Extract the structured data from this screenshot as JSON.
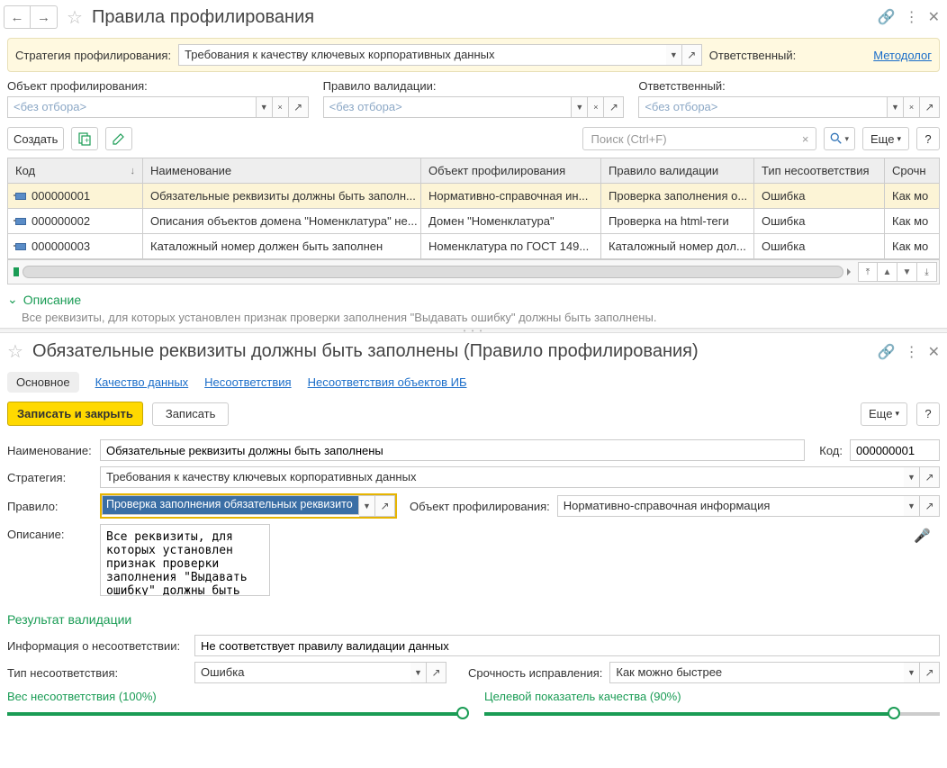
{
  "top": {
    "title": "Правила профилирования",
    "strategy_label": "Стратегия профилирования:",
    "strategy_value": "Требования к качеству ключевых корпоративных данных",
    "responsible_label": "Ответственный:",
    "responsible_link": "Методолог",
    "filters": [
      {
        "label": "Объект профилирования:",
        "placeholder": "<без отбора>"
      },
      {
        "label": "Правило валидации:",
        "placeholder": "<без отбора>"
      },
      {
        "label": "Ответственный:",
        "placeholder": "<без отбора>"
      }
    ],
    "toolbar": {
      "create": "Создать",
      "search_placeholder": "Поиск (Ctrl+F)",
      "more": "Еще",
      "help": "?"
    },
    "columns": {
      "code": "Код",
      "name": "Наименование",
      "obj": "Объект профилирования",
      "rule": "Правило валидации",
      "type": "Тип несоответствия",
      "urg": "Срочн"
    },
    "rows": [
      {
        "code": "000000001",
        "name": "Обязательные реквизиты должны быть заполн...",
        "obj": "Нормативно-справочная ин...",
        "rule": "Проверка заполнения о...",
        "type": "Ошибка",
        "urg": "Как мо"
      },
      {
        "code": "000000002",
        "name": "Описания объектов домена \"Номенклатура\" не...",
        "obj": "Домен \"Номенклатура\"",
        "rule": "Проверка на html-теги",
        "type": "Ошибка",
        "urg": "Как мо"
      },
      {
        "code": "000000003",
        "name": "Каталожный номер должен быть заполнен",
        "obj": "Номенклатура по ГОСТ 149...",
        "rule": "Каталожный номер дол...",
        "type": "Ошибка",
        "urg": "Как мо"
      }
    ],
    "desc_title": "Описание",
    "desc_text": "Все реквизиты, для которых установлен признак проверки заполнения \"Выдавать ошибку\" должны быть заполнены."
  },
  "bottom": {
    "title": "Обязательные реквизиты должны быть заполнены (Правило профилирования)",
    "tabs": [
      "Основное",
      "Качество данных",
      "Несоответствия",
      "Несоответствия объектов ИБ"
    ],
    "save_close": "Записать и закрыть",
    "save": "Записать",
    "more": "Еще",
    "help": "?",
    "fields": {
      "name_label": "Наименование:",
      "name_value": "Обязательные реквизиты должны быть заполнены",
      "code_label": "Код:",
      "code_value": "000000001",
      "strategy_label": "Стратегия:",
      "strategy_value": "Требования к качеству ключевых корпоративных данных",
      "rule_label": "Правило:",
      "rule_value": "Проверка заполнения обязательных реквизито",
      "obj_label": "Объект профилирования:",
      "obj_value": "Нормативно-справочная информация",
      "desc_label": "Описание:",
      "desc_value": "Все реквизиты, для которых установлен признак проверки заполнения \"Выдавать ошибку\" должны быть заполнены."
    },
    "result_title": "Результат валидации",
    "info_label": "Информация о несоответствии:",
    "info_value": "Не соответствует правилу валидации данных",
    "type_label": "Тип несоответствия:",
    "type_value": "Ошибка",
    "urg_label": "Срочность исправления:",
    "urg_value": "Как можно быстрее",
    "weight_label": "Вес несоответствия (100%)",
    "target_label": "Целевой показатель качества (90%)",
    "weight_pct": 100,
    "target_pct": 90
  }
}
